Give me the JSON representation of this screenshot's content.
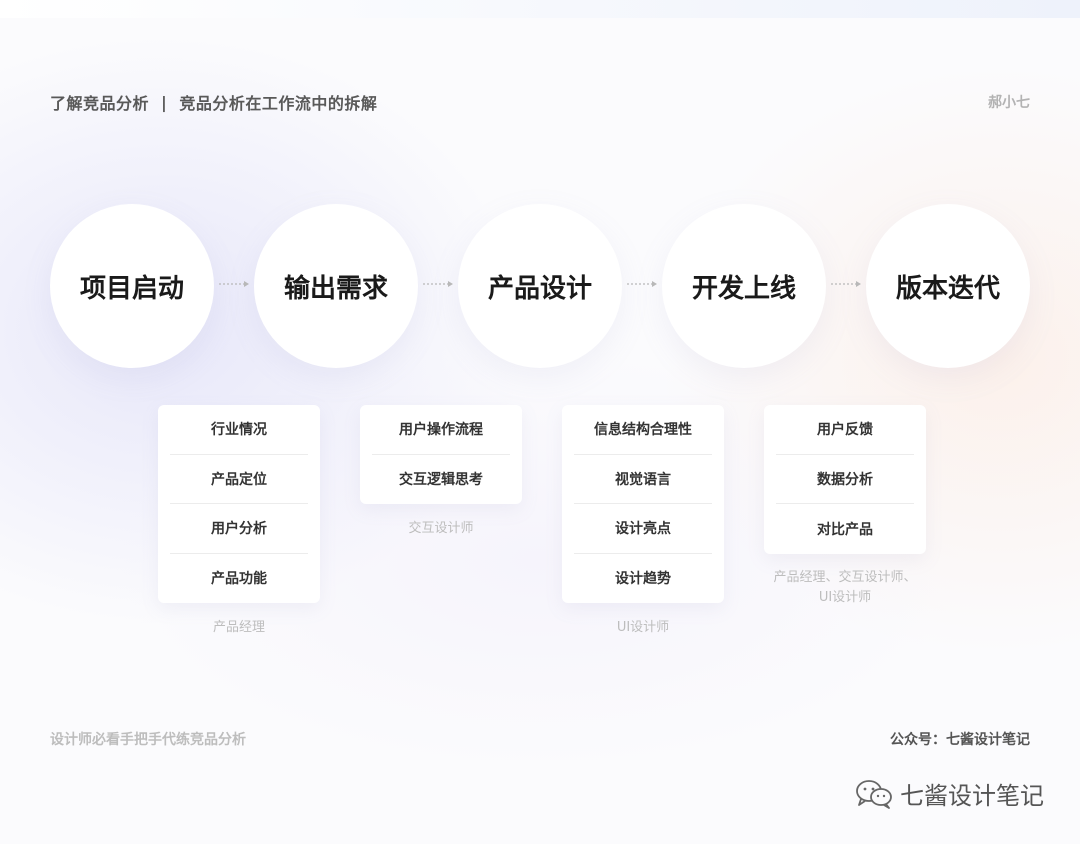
{
  "header": {
    "topic": "了解竞品分析",
    "separator": "|",
    "subtitle": "竞品分析在工作流中的拆解",
    "author": "郝小七"
  },
  "stages": [
    {
      "label": "项目启动",
      "items": [
        "行业情况",
        "产品定位",
        "用户分析",
        "产品功能"
      ],
      "role": "产品经理"
    },
    {
      "label": "输出需求",
      "items": [
        "用户操作流程",
        "交互逻辑思考"
      ],
      "role": "交互设计师"
    },
    {
      "label": "产品设计",
      "items": [
        "信息结构合理性",
        "视觉语言",
        "设计亮点",
        "设计趋势"
      ],
      "role": "UI设计师"
    },
    {
      "label": "开发上线",
      "items": [
        "用户反馈",
        "数据分析",
        "对比产品"
      ],
      "role_line1": "产品经理、交互设计师、",
      "role_line2": "UI设计师"
    },
    {
      "label": "版本迭代"
    }
  ],
  "footer": {
    "left": "设计师必看手把手代练竞品分析",
    "right": "公众号：七酱设计笔记",
    "watermark": "七酱设计笔记",
    "watermark_icon": "wechat-icon"
  },
  "colors": {
    "circle_bg": "#ffffff",
    "arrow": "#b8b8b8",
    "role_text": "#bdbdbd"
  }
}
